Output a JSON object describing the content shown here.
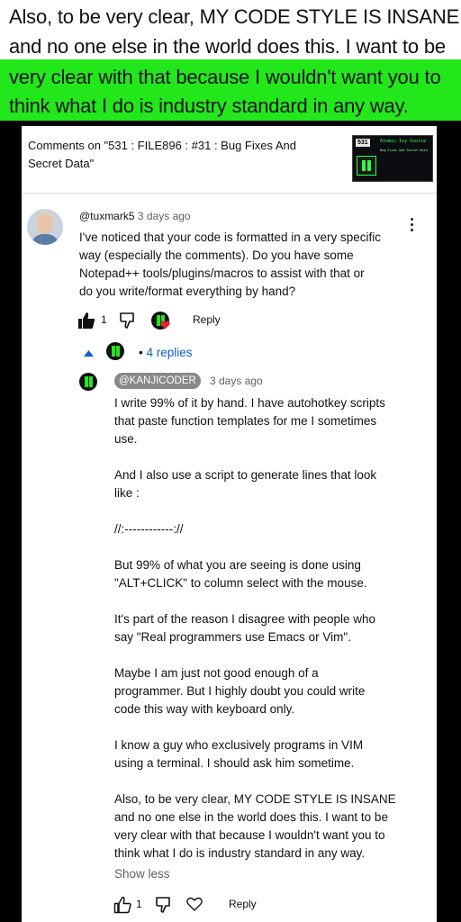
{
  "caption": {
    "line1": "Also, to be very clear, MY CODE STYLE IS INSANE",
    "line2": "and no one else in the world does this. I want to be",
    "line3": "very clear with that because I wouldn't want you to",
    "line4": "think what I do is industry standard in any way."
  },
  "header": {
    "title": "Comments on \"531 : FILE896 : #31 : Bug Fixes And Secret Data\"",
    "thumbnail": {
      "number": "531",
      "title": "Atomic Ivy Source",
      "subtitle": "Bug Fixes And Secret Data"
    }
  },
  "comment": {
    "author": "@tuxmark5",
    "time": "3 days ago",
    "lines": [
      "I've noticed that your code is formatted in a very specific",
      "way (especially the comments). Do you have some",
      "Notepad++ tools/plugins/macros to assist with that or",
      "do you write/format everything by hand?"
    ],
    "likes": "1",
    "reply_label": "Reply"
  },
  "replies": {
    "count_label": "4 replies"
  },
  "reply": {
    "author": "@KANJICODER",
    "time": "3 days ago",
    "lines": [
      "I write 99% of it by hand. I have autohotkey scripts",
      "that paste function templates for me I sometimes",
      "use.",
      "",
      "And I also use a script to generate lines that look",
      "like :",
      "",
      "//:------------://",
      "",
      "But 99% of what you are seeing is done using",
      "\"ALT+CLICK\" to column select with the mouse.",
      "",
      "It's part of the reason I disagree with people who",
      "say \"Real programmers use Emacs or Vim\".",
      "",
      "Maybe I am just not good enough of a",
      "programmer. But I highly doubt you could write",
      "code this way with keyboard only.",
      "",
      "I know a guy who exclusively programs in VIM",
      "using a terminal. I should ask him sometime.",
      "",
      "Also, to be very clear, MY CODE STYLE IS INSANE",
      "and no one else in the world does this. I want to be",
      "very clear with that because I wouldn't want you to",
      "think what I do is industry standard in any way."
    ],
    "show_less": "Show less",
    "likes": "1",
    "reply_label": "Reply"
  },
  "colors": {
    "highlight": "#22e81b",
    "link": "#065fd4",
    "heart": "#e0242f"
  }
}
